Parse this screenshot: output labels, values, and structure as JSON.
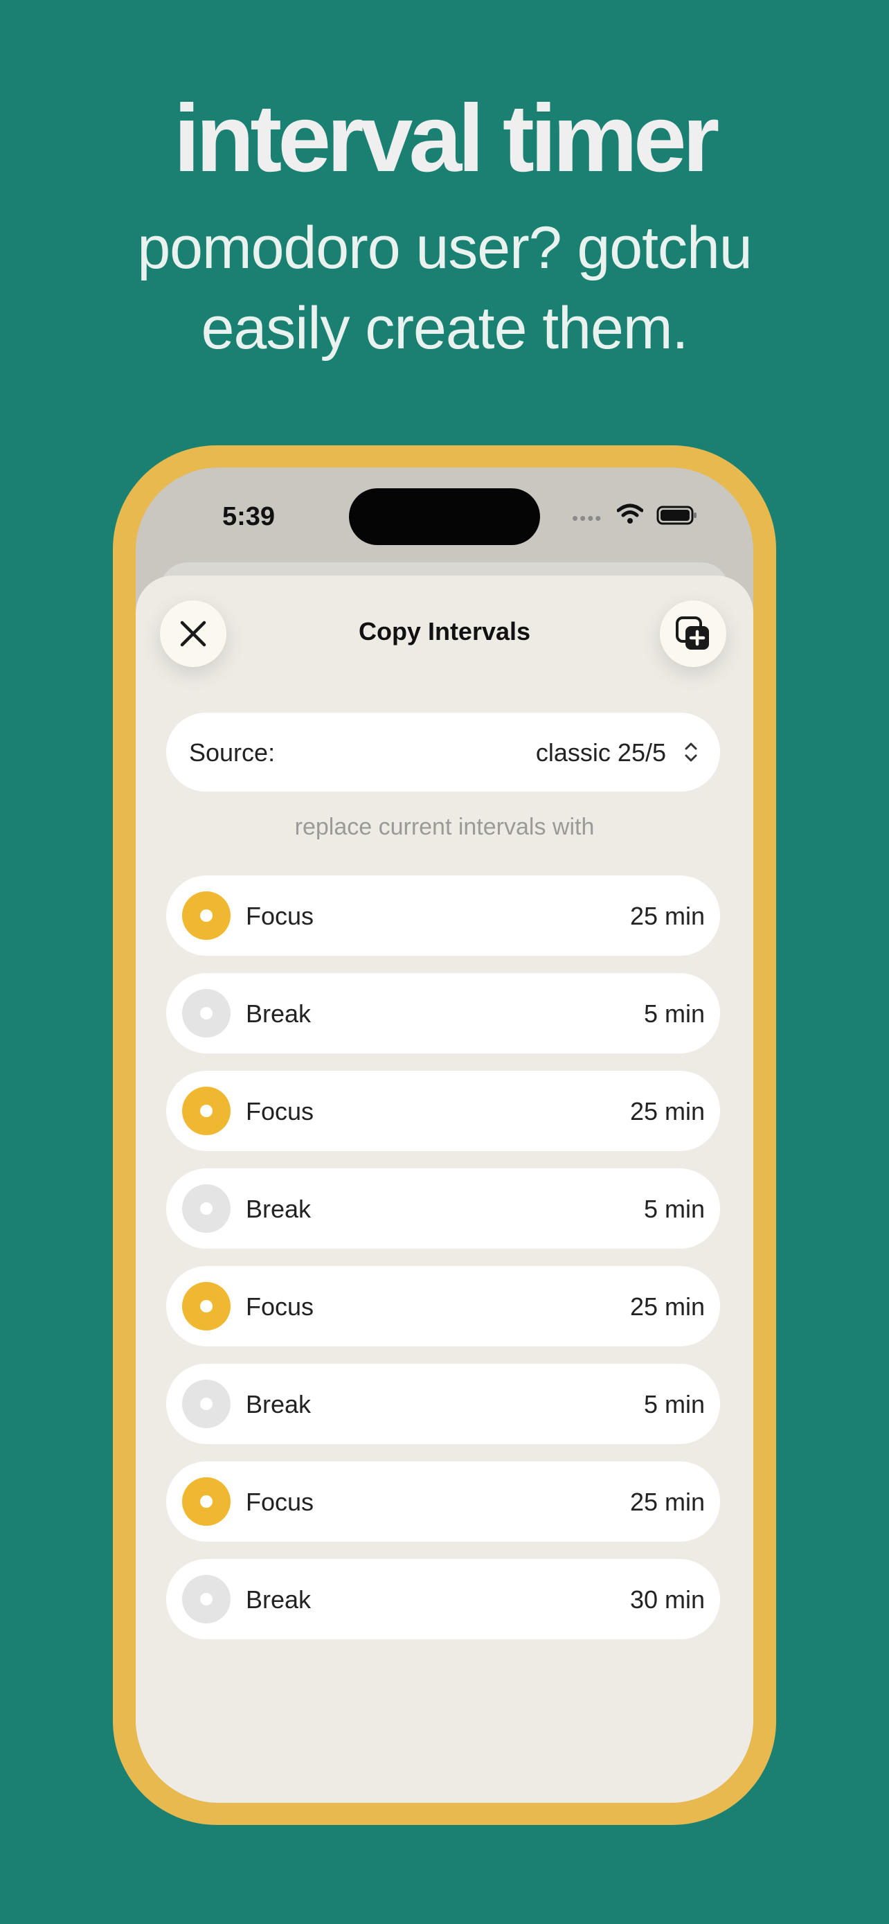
{
  "header": {
    "title": "interval timer",
    "subtitle_line1": "pomodoro user? gotchu",
    "subtitle_line2": "easily create them."
  },
  "status_bar": {
    "time": "5:39",
    "dots": "••••"
  },
  "sheet": {
    "title": "Copy Intervals",
    "close_icon": "close-icon",
    "copy_icon": "copy-plus-icon"
  },
  "source": {
    "label": "Source:",
    "value": "classic 25/5"
  },
  "hint": "replace current intervals with",
  "colors": {
    "background": "#1a8172",
    "frame": "#e8b94f",
    "focus": "#f0b830",
    "break": "#e4e4e4"
  },
  "intervals": [
    {
      "label": "Focus",
      "duration": "25 min",
      "type": "focus"
    },
    {
      "label": "Break",
      "duration": "5 min",
      "type": "break"
    },
    {
      "label": "Focus",
      "duration": "25 min",
      "type": "focus"
    },
    {
      "label": "Break",
      "duration": "5 min",
      "type": "break"
    },
    {
      "label": "Focus",
      "duration": "25 min",
      "type": "focus"
    },
    {
      "label": "Break",
      "duration": "5 min",
      "type": "break"
    },
    {
      "label": "Focus",
      "duration": "25 min",
      "type": "focus"
    },
    {
      "label": "Break",
      "duration": "30 min",
      "type": "break"
    }
  ]
}
